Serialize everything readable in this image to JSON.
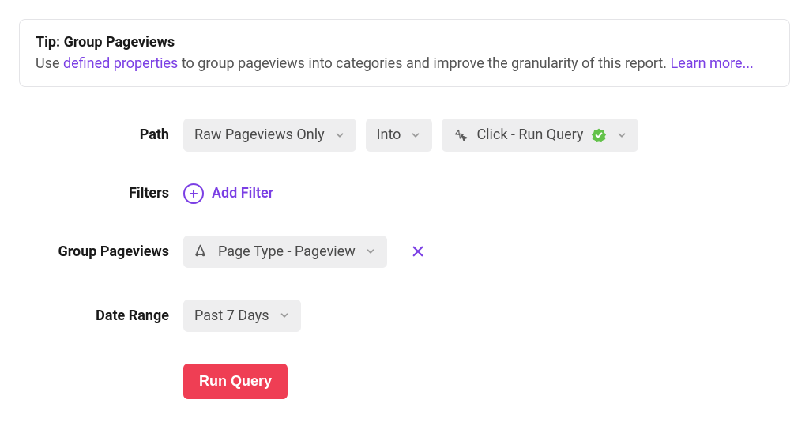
{
  "tip": {
    "title": "Tip: Group Pageviews",
    "pre_link_text": "Use ",
    "link_text": "defined properties",
    "post_link_text": " to group pageviews into categories and improve the granularity of this report. ",
    "learn_more": "Learn more..."
  },
  "form": {
    "path": {
      "label": "Path",
      "start": "Raw Pageviews Only",
      "direction": "Into",
      "target": "Click - Run Query"
    },
    "filters": {
      "label": "Filters",
      "add_filter_label": "Add Filter"
    },
    "group": {
      "label": "Group Pageviews",
      "value": "Page Type - Pageview"
    },
    "date_range": {
      "label": "Date Range",
      "value": "Past 7 Days"
    },
    "run_query_label": "Run Query"
  },
  "colors": {
    "accent_purple": "#7b3fe4",
    "chip_bg": "#eeeeef",
    "danger": "#ef3e54",
    "badge_green": "#63c24a"
  }
}
